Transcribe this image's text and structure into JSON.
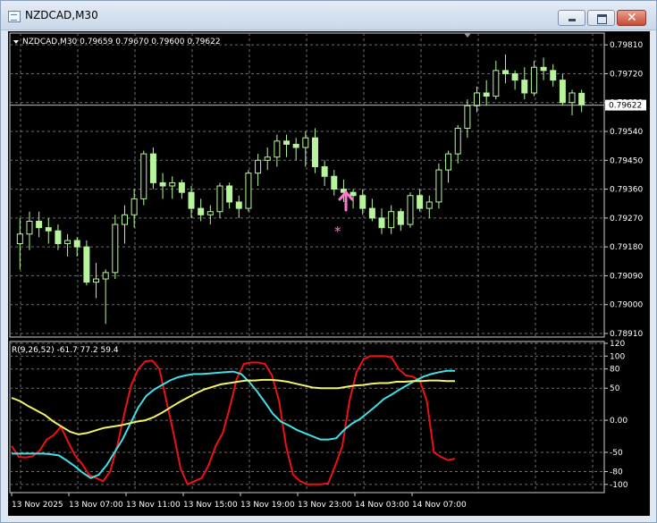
{
  "window": {
    "title": "NZDCAD,M30",
    "app_icon": "chart-window-icon",
    "buttons": {
      "minimize": "minimize-icon",
      "maximize": "maximize-icon",
      "close": "close-icon"
    }
  },
  "main_chart": {
    "header": "NZDCAD,M30  0.79659 0.79670 0.79600 0.79622",
    "price_labels": [
      "0.79810",
      "0.79720",
      "0.79630",
      "0.79540",
      "0.79450",
      "0.79360",
      "0.79270",
      "0.79180",
      "0.79090",
      "0.79000",
      "0.78910"
    ],
    "current_price": "0.79622",
    "markers": {
      "buy_arrow": "up-arrow-icon",
      "star": "star-icon"
    }
  },
  "indicator": {
    "label": "R(9,26,52) -61.7 77.2 59.4",
    "levels": [
      "120",
      "100",
      "80",
      "50",
      "0.00",
      "-50",
      "-80",
      "-100"
    ]
  },
  "time_labels": [
    "13 Nov 2025",
    "13 Nov 07:00",
    "13 Nov 11:00",
    "13 Nov 15:00",
    "13 Nov 19:00",
    "13 Nov 23:00",
    "14 Nov 03:00",
    "14 Nov 07:00"
  ],
  "colors": {
    "background": "#000000",
    "grid": "#6e6e6e",
    "candles": "#b7f59c",
    "arrow": "#ff77d5",
    "line_red": "#ee1111",
    "line_cyan": "#40e0e8",
    "line_yellow": "#f3f36a",
    "text": "#ffffff"
  },
  "chart_data": [
    {
      "type": "candlestick",
      "symbol": "NZDCAD",
      "timeframe": "M30",
      "ylim": [
        0.7891,
        0.7983
      ],
      "x_labels": [
        "13 Nov 2025",
        "13 Nov 07:00",
        "13 Nov 11:00",
        "13 Nov 15:00",
        "13 Nov 19:00",
        "13 Nov 23:00",
        "14 Nov 03:00",
        "14 Nov 07:00"
      ],
      "ohlc": [
        [
          0.7919,
          0.7927,
          0.7911,
          0.7922
        ],
        [
          0.7922,
          0.7929,
          0.7917,
          0.7926
        ],
        [
          0.7926,
          0.7929,
          0.7921,
          0.7924
        ],
        [
          0.7924,
          0.7927,
          0.7919,
          0.7923
        ],
        [
          0.7923,
          0.7925,
          0.7917,
          0.7919
        ],
        [
          0.7919,
          0.7922,
          0.7915,
          0.792
        ],
        [
          0.792,
          0.7921,
          0.7915,
          0.7918
        ],
        [
          0.7918,
          0.792,
          0.7906,
          0.7907
        ],
        [
          0.7907,
          0.7913,
          0.7902,
          0.7908
        ],
        [
          0.7908,
          0.7911,
          0.7894,
          0.791
        ],
        [
          0.791,
          0.7928,
          0.7908,
          0.7925
        ],
        [
          0.7925,
          0.7931,
          0.7919,
          0.7928
        ],
        [
          0.7928,
          0.7936,
          0.7924,
          0.7933
        ],
        [
          0.7933,
          0.7948,
          0.7931,
          0.7947
        ],
        [
          0.7947,
          0.7949,
          0.7936,
          0.7938
        ],
        [
          0.7938,
          0.7941,
          0.7933,
          0.7937
        ],
        [
          0.7937,
          0.794,
          0.7933,
          0.7938
        ],
        [
          0.7938,
          0.7939,
          0.7933,
          0.7935
        ],
        [
          0.7935,
          0.7937,
          0.7927,
          0.793
        ],
        [
          0.793,
          0.7933,
          0.7926,
          0.7928
        ],
        [
          0.7928,
          0.7931,
          0.7925,
          0.7929
        ],
        [
          0.7929,
          0.7938,
          0.7927,
          0.7937
        ],
        [
          0.7937,
          0.7938,
          0.793,
          0.7932
        ],
        [
          0.7932,
          0.7934,
          0.7927,
          0.793
        ],
        [
          0.793,
          0.7942,
          0.7929,
          0.7941
        ],
        [
          0.7941,
          0.7947,
          0.7937,
          0.7945
        ],
        [
          0.7945,
          0.7949,
          0.7942,
          0.7946
        ],
        [
          0.7946,
          0.7953,
          0.7943,
          0.7951
        ],
        [
          0.7951,
          0.7953,
          0.7946,
          0.795
        ],
        [
          0.795,
          0.7952,
          0.7945,
          0.7949
        ],
        [
          0.7949,
          0.7954,
          0.7943,
          0.7952
        ],
        [
          0.7952,
          0.7955,
          0.7941,
          0.7943
        ],
        [
          0.7943,
          0.7945,
          0.7937,
          0.794
        ],
        [
          0.794,
          0.7942,
          0.7934,
          0.7936
        ],
        [
          0.7936,
          0.7939,
          0.7932,
          0.7935
        ],
        [
          0.7935,
          0.7936,
          0.793,
          0.7934
        ],
        [
          0.7934,
          0.7936,
          0.7928,
          0.793
        ],
        [
          0.793,
          0.7933,
          0.7926,
          0.7927
        ],
        [
          0.7927,
          0.793,
          0.7922,
          0.7924
        ],
        [
          0.7924,
          0.7931,
          0.7922,
          0.7929
        ],
        [
          0.7929,
          0.793,
          0.7923,
          0.7925
        ],
        [
          0.7925,
          0.7935,
          0.7924,
          0.7934
        ],
        [
          0.7934,
          0.7936,
          0.7929,
          0.793
        ],
        [
          0.793,
          0.7934,
          0.7927,
          0.7932
        ],
        [
          0.7932,
          0.7944,
          0.793,
          0.7942
        ],
        [
          0.7942,
          0.7948,
          0.7938,
          0.7947
        ],
        [
          0.7947,
          0.7956,
          0.7944,
          0.7955
        ],
        [
          0.7955,
          0.7964,
          0.7952,
          0.7962
        ],
        [
          0.7962,
          0.7968,
          0.796,
          0.7966
        ],
        [
          0.7966,
          0.797,
          0.7962,
          0.7965
        ],
        [
          0.7965,
          0.7976,
          0.7964,
          0.7973
        ],
        [
          0.7973,
          0.7978,
          0.7969,
          0.7972
        ],
        [
          0.7972,
          0.7973,
          0.7967,
          0.797
        ],
        [
          0.797,
          0.7974,
          0.7964,
          0.7966
        ],
        [
          0.7966,
          0.7976,
          0.7965,
          0.7974
        ],
        [
          0.7974,
          0.7977,
          0.797,
          0.7973
        ],
        [
          0.7973,
          0.7975,
          0.7968,
          0.797
        ],
        [
          0.797,
          0.7972,
          0.7962,
          0.7963
        ],
        [
          0.7963,
          0.7967,
          0.7959,
          0.7966
        ],
        [
          0.79659,
          0.7967,
          0.796,
          0.79622
        ]
      ]
    },
    {
      "type": "line",
      "label": "R(9,26,52) -61.7 77.2 59.4",
      "ylim": [
        -110,
        120
      ],
      "series": [
        {
          "color": "#ee1111",
          "values": [
            -40,
            -57,
            -58,
            -56,
            -47,
            -30,
            -23,
            -10,
            -33,
            -55,
            -68,
            -85,
            -90,
            -95,
            -80,
            -40,
            10,
            55,
            80,
            92,
            93,
            80,
            30,
            -20,
            -75,
            -100,
            -95,
            -90,
            -70,
            -40,
            -20,
            20,
            65,
            88,
            90,
            90,
            88,
            70,
            30,
            -40,
            -85,
            -95,
            -100,
            -100,
            -100,
            -98,
            -70,
            -40,
            30,
            75,
            95,
            100,
            100,
            100,
            98,
            80,
            70,
            68,
            62,
            30,
            -50,
            -57,
            -62,
            -60
          ]
        },
        {
          "color": "#40e0e8",
          "values": [
            -52,
            -52,
            -52,
            -52,
            -52,
            -53,
            -55,
            -63,
            -72,
            -82,
            -90,
            -85,
            -70,
            -50,
            -30,
            -5,
            20,
            38,
            48,
            55,
            62,
            67,
            70,
            72,
            72,
            73,
            74,
            75,
            76,
            72,
            60,
            45,
            28,
            10,
            -2,
            -8,
            -15,
            -20,
            -25,
            -30,
            -30,
            -28,
            -15,
            -5,
            2,
            12,
            22,
            33,
            40,
            48,
            55,
            62,
            68,
            72,
            75,
            77,
            77
          ]
        },
        {
          "color": "#f3f36a",
          "values": [
            35,
            30,
            22,
            15,
            8,
            -2,
            -10,
            -18,
            -22,
            -20,
            -16,
            -12,
            -10,
            -8,
            -5,
            -2,
            0,
            5,
            12,
            20,
            28,
            35,
            42,
            48,
            52,
            56,
            58,
            60,
            62,
            62,
            63,
            63,
            62,
            60,
            57,
            54,
            51,
            50,
            50,
            50,
            52,
            54,
            55,
            57,
            58,
            58,
            60,
            60,
            61,
            61,
            62,
            62,
            61,
            61
          ]
        }
      ]
    }
  ]
}
